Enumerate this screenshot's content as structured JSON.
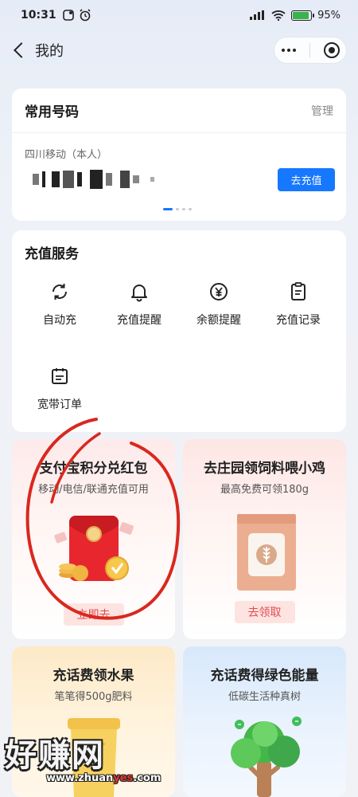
{
  "status_bar": {
    "time": "10:31",
    "battery": "95%",
    "battery_level": 0.95
  },
  "header": {
    "title": "我的"
  },
  "phone_card": {
    "title": "常用号码",
    "manage_label": "管理",
    "carrier": "四川移动（本人）",
    "recharge_label": "去充值"
  },
  "service": {
    "title": "充值服务",
    "items": [
      {
        "label": "自动充",
        "icon": "refresh-icon"
      },
      {
        "label": "充值提醒",
        "icon": "bell-icon"
      },
      {
        "label": "余额提醒",
        "icon": "yuan-circle-icon"
      },
      {
        "label": "充值记录",
        "icon": "clipboard-icon"
      },
      {
        "label": "宽带订单",
        "icon": "calendar-icon"
      }
    ]
  },
  "promos": [
    {
      "title": "支付宝积分兑红包",
      "subtitle": "移动/电信/联通充值可用",
      "button": "立即去"
    },
    {
      "title": "去庄园领饲料喂小鸡",
      "subtitle": "最高免费可领180g",
      "button": "去领取"
    },
    {
      "title": "充话费领水果",
      "subtitle": "笔笔得500g肥料"
    },
    {
      "title": "充话费得绿色能量",
      "subtitle": "低碳生活种真树"
    }
  ],
  "watermark": {
    "text": "好赚网",
    "url_prefix": "www.zhuan",
    "url_highlight": "yes",
    "url_suffix": ".com"
  },
  "colors": {
    "accent": "#1677ff",
    "promo_red": "#e5484d",
    "annotation": "#d9281e"
  }
}
